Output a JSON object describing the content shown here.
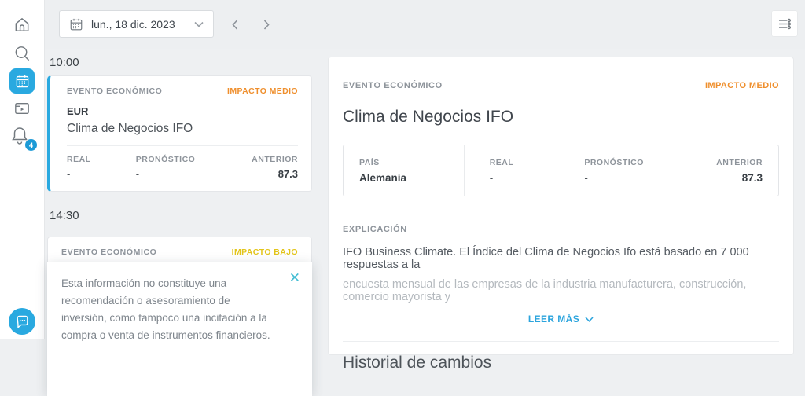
{
  "colors": {
    "accent_blue": "#29a9e0",
    "impact_medium_orange": "#ef8f2d",
    "impact_low_yellow": "#e3c51a",
    "close_teal": "#44bdd3",
    "badge_blue": "#1c9ad6"
  },
  "icons": {
    "close": "✕"
  },
  "sidebar": {
    "notification_count": "4"
  },
  "topbar": {
    "date_label": "lun., 18 dic. 2023"
  },
  "event_list": {
    "groups": [
      {
        "time": "10:00",
        "kicker": "EVENTO ECONÓMICO",
        "impact": "IMPACTO MEDIO",
        "currency": "EUR",
        "title": "Clima de Negocios IFO",
        "stats": [
          {
            "label": "REAL",
            "value": "-"
          },
          {
            "label": "PRONÓSTICO",
            "value": "-"
          },
          {
            "label": "ANTERIOR",
            "value": "87.3"
          }
        ]
      },
      {
        "time": "14:30",
        "kicker": "EVENTO ECONÓMICO",
        "impact": "IMPACTO BAJO"
      }
    ]
  },
  "disclaimer": {
    "text": "Esta información no constituye una recomendación o asesoramiento de inversión, como tampoco una incitación a la compra o venta de instrumentos financieros."
  },
  "detail": {
    "kicker": "EVENTO ECONÓMICO",
    "impact": "IMPACTO MEDIO",
    "title": "Clima de Negocios IFO",
    "table": {
      "cols": [
        {
          "label": "PAÍS",
          "value": "Alemania"
        },
        {
          "label": "REAL",
          "value": "-"
        },
        {
          "label": "PRONÓSTICO",
          "value": "-"
        },
        {
          "label": "ANTERIOR",
          "value": "87.3"
        }
      ]
    },
    "explanation_label": "EXPLICACIÓN",
    "explanation_line1": "IFO Business Climate. El Índice del Clima de Negocios Ifo está basado en 7 000 respuestas a la",
    "explanation_line2": "encuesta mensual de las empresas de la industria manufacturera, construcción, comercio mayorista y",
    "read_more": "LEER MÁS",
    "history_title": "Historial de cambios"
  }
}
